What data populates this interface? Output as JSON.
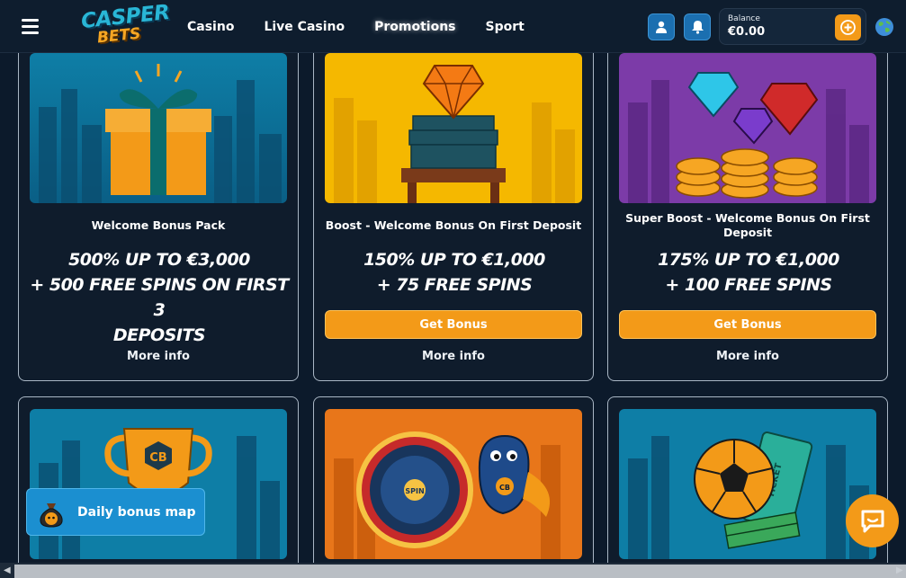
{
  "header": {
    "logo_top": "CASPER",
    "logo_bottom": "BETS",
    "nav": [
      "Casino",
      "Live Casino",
      "Promotions",
      "Sport"
    ],
    "balance_label": "Balance",
    "balance_value": "€0.00"
  },
  "cards": [
    {
      "title": "Welcome Bonus Pack",
      "offer": [
        "500% UP TO €3,000",
        "+ 500 FREE SPINS ON FIRST 3",
        "DEPOSITS"
      ],
      "button": "",
      "more": "More info",
      "art": "gift-box"
    },
    {
      "title": "Boost - Welcome Bonus On First Deposit",
      "offer": [
        "150% UP TO €1,000",
        "+ 75 FREE SPINS"
      ],
      "button": "Get Bonus",
      "more": "More info",
      "art": "diamond-on-cash"
    },
    {
      "title": "Super Boost - Welcome Bonus On First Deposit",
      "offer": [
        "175% UP TO €1,000",
        "+ 100 FREE SPINS"
      ],
      "button": "Get Bonus",
      "more": "More info",
      "art": "gems-and-coins"
    },
    {
      "art": "trophy"
    },
    {
      "art": "spin-wheel-ghost"
    },
    {
      "art": "football-ticket"
    }
  ],
  "art_text": {
    "trophy": "CB",
    "wheel": "SPIN",
    "ghost": "CB",
    "ticket": "TICKET"
  },
  "daily_bonus": "Daily bonus map",
  "colors": {
    "accent": "#f39a18",
    "bg": "#0c1a2b",
    "blue": "#1b8fd0"
  }
}
